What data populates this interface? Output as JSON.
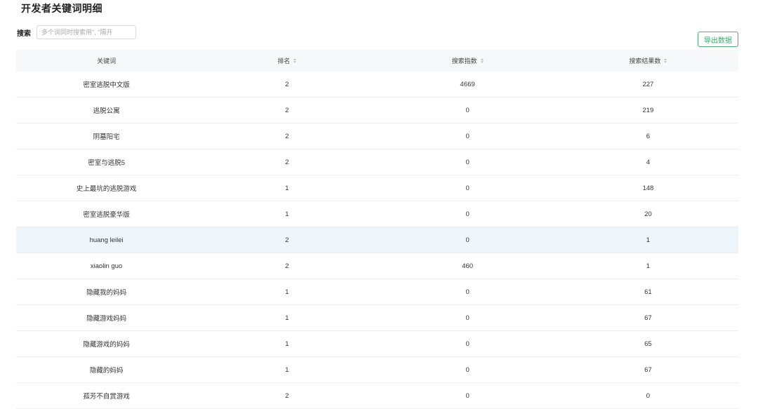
{
  "page": {
    "title": "开发者关键词明细"
  },
  "search": {
    "label": "搜索",
    "placeholder": "多个词同时搜索用\", \"隔开"
  },
  "toolbar": {
    "export_label": "导出数据"
  },
  "table": {
    "columns": [
      "关键词",
      "排名",
      "搜索指数",
      "搜索结果数"
    ],
    "rows": [
      [
        "密室逃脱中文版",
        "2",
        "4669",
        "227"
      ],
      [
        "逃脱公寓",
        "2",
        "0",
        "219"
      ],
      [
        "阴墓阳宅",
        "2",
        "0",
        "6"
      ],
      [
        "密室与逃脱5",
        "2",
        "0",
        "4"
      ],
      [
        "史上最坑的逃脱游戏",
        "1",
        "0",
        "148"
      ],
      [
        "密室逃脱豪华版",
        "1",
        "0",
        "20"
      ],
      [
        "huang leilei",
        "2",
        "0",
        "1"
      ],
      [
        "xiaolin guo",
        "2",
        "460",
        "1"
      ],
      [
        "隐藏我的妈妈",
        "1",
        "0",
        "61"
      ],
      [
        "隐藏游戏妈妈",
        "1",
        "0",
        "67"
      ],
      [
        "隐藏游戏的妈妈",
        "1",
        "0",
        "65"
      ],
      [
        "隐藏的妈妈",
        "1",
        "0",
        "67"
      ],
      [
        "孤芳不自赏游戏",
        "2",
        "0",
        "0"
      ]
    ],
    "highlighted_row": 6
  },
  "colors": {
    "accent": "#3aa868",
    "header_bg": "#f7f8fa",
    "highlight_bg": "#eef6fc"
  }
}
